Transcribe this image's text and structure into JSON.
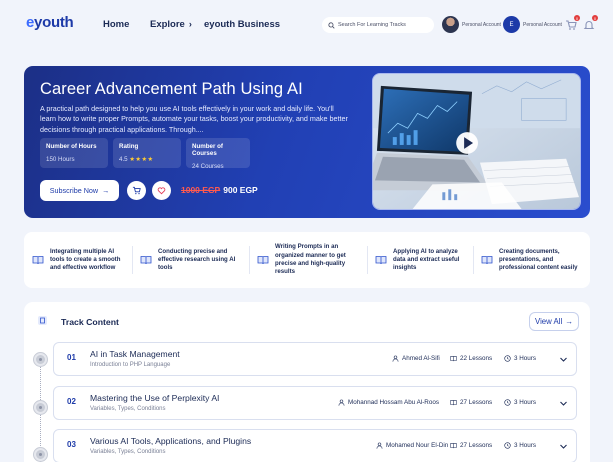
{
  "nav": {
    "logo": "youth",
    "logo_prefix": "e",
    "links": [
      "Home",
      "Explore",
      "eyouth Business"
    ],
    "explore_chevron": "chevron-right-icon",
    "search_placeholder": "Search For Learning Tracks",
    "accounts": [
      "Personal Account",
      "Personal Account"
    ],
    "avatar_initial": "E",
    "cart_badge": "0",
    "notification_badge": "0"
  },
  "hero": {
    "title": "Career Advancement Path Using AI",
    "description": "A practical path designed to help you use AI tools effectively in your work and daily life. You'll learn how to write proper Prompts, automate your tasks, boost your productivity, and make better decisions through practical applications. Through....",
    "stats": [
      {
        "label": "Number of Hours",
        "value": "150 Hours"
      },
      {
        "label": "Rating",
        "value": "4.5",
        "stars": "★★★★"
      },
      {
        "label": "Number of Courses",
        "value": "24 Courses"
      }
    ],
    "subscribe_label": "Subscribe Now",
    "old_price": "1000 EGP",
    "new_price": "900 EGP",
    "colors": {
      "hero_bg": "#2140b4",
      "old_price": "#ff5a4f",
      "stars": "#ffcc33"
    }
  },
  "features": [
    "Integrating multiple AI tools to create a smooth and effective workflow",
    "Conducting precise and effective research using AI tools",
    "Writing Prompts in an organized manner to get precise and high-quality results",
    "Applying AI to analyze data and extract useful insights",
    "Creating documents, presentations, and professional content easily"
  ],
  "track": {
    "title": "Track Content",
    "view_all": "View All",
    "courses": [
      {
        "num": "01",
        "title": "AI in Task Management",
        "subtitle": "Introduction to PHP Language",
        "instructor": "Ahmed Al-Sifi",
        "lessons": "22 Lessons",
        "hours": "3 Hours"
      },
      {
        "num": "02",
        "title": "Mastering the Use of Perplexity AI",
        "subtitle": "Variables, Types, Conditions",
        "instructor": "Mohannad Hossam Abu Al-Roos",
        "lessons": "27 Lessons",
        "hours": "3 Hours"
      },
      {
        "num": "03",
        "title": "Various AI Tools, Applications, and Plugins",
        "subtitle": "Variables, Types, Conditions",
        "instructor": "Mohamed Nour El-Din",
        "lessons": "27 Lessons",
        "hours": "3 Hours"
      }
    ]
  }
}
